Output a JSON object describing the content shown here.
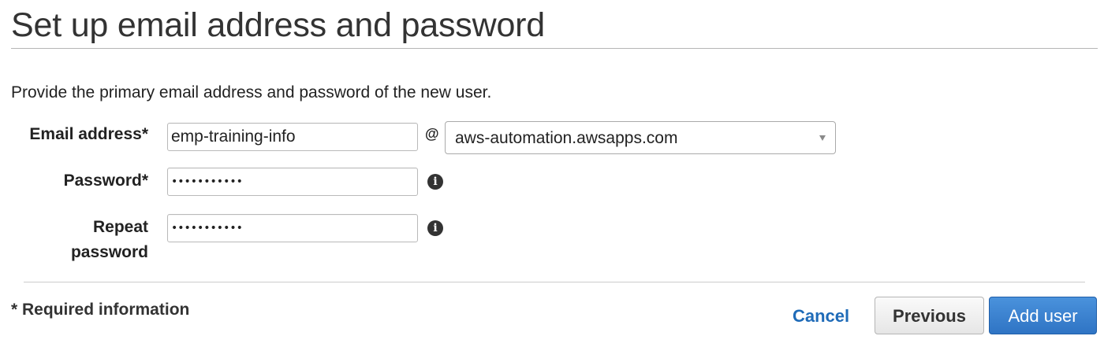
{
  "page": {
    "title": "Set up email address and password",
    "intro": "Provide the primary email address and password of the new user."
  },
  "form": {
    "email_label": "Email address*",
    "email_value": "emp-training-info",
    "at_symbol": "@",
    "domain_selected": "aws-automation.awsapps.com",
    "password_label": "Password*",
    "password_value": "•••••••••••",
    "repeat_label_line1": "Repeat",
    "repeat_label_line2": "password",
    "repeat_value": "•••••••••••",
    "info_icon_glyph": "i"
  },
  "footer": {
    "required_note": "* Required information",
    "cancel_label": "Cancel",
    "previous_label": "Previous",
    "add_user_label": "Add user"
  },
  "colors": {
    "link": "#1f6bb8",
    "primary_button": "#2f74c4",
    "heading": "#333333"
  },
  "icons": {
    "info": "info-icon",
    "dropdown": "chevron-down-icon"
  }
}
